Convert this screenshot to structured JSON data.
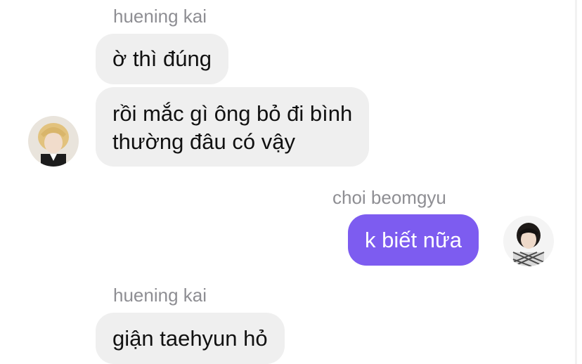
{
  "chat": {
    "messages": [
      {
        "sender": "huening kai",
        "side": "incoming",
        "bubbles": [
          "ờ thì đúng",
          "rồi mắc gì ông bỏ đi bình\nthường đâu có vậy"
        ]
      },
      {
        "sender": "choi beomgyu",
        "side": "outgoing",
        "bubbles": [
          "k biết nữa"
        ]
      },
      {
        "sender": "huening kai",
        "side": "incoming",
        "bubbles": [
          "giận taehyun hỏ"
        ]
      }
    ]
  },
  "colors": {
    "incoming_bubble": "#efefef",
    "outgoing_bubble": "#7d5cf0",
    "sender_name": "#8e8e93"
  }
}
